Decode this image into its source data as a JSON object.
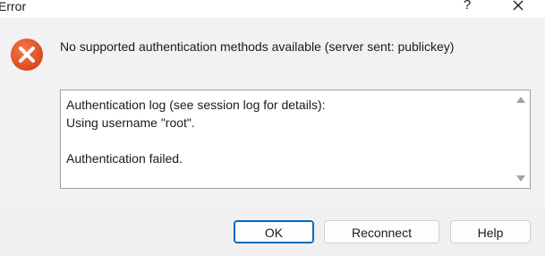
{
  "window": {
    "title": "Error",
    "help_glyph": "?",
    "close_icon": "close-icon"
  },
  "dialog": {
    "icon": "error-icon",
    "icon_color": "#e0501f",
    "message": "No supported authentication methods available (server sent: publickey)",
    "log_text": "Authentication log (see session log for details):\nUsing username \"root\".\n\nAuthentication failed."
  },
  "buttons": {
    "ok": "OK",
    "reconnect": "Reconnect",
    "help": "Help"
  },
  "colors": {
    "accent": "#0067c0",
    "panel_bg": "#f2f2f2"
  }
}
